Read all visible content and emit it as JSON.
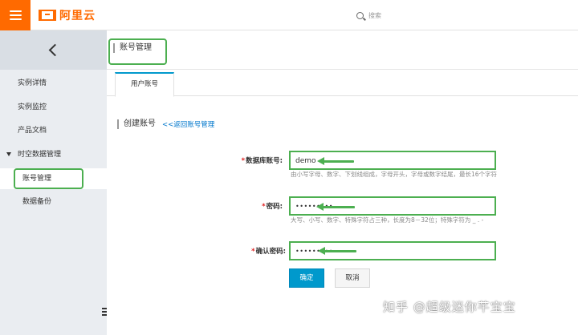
{
  "header": {
    "logo_text": "阿里云",
    "search_placeholder": "搜索"
  },
  "sidebar": {
    "items": [
      {
        "label": "实例详情"
      },
      {
        "label": "实例监控"
      },
      {
        "label": "产品文档"
      }
    ],
    "group": {
      "label": "时空数据管理",
      "expanded": true
    },
    "sub_items": [
      {
        "label": "账号管理",
        "active": true
      },
      {
        "label": "数据备份"
      }
    ]
  },
  "main": {
    "page_title": "账号管理",
    "tabs": [
      {
        "label": "用户账号",
        "active": true
      }
    ],
    "section_title": "创建账号",
    "back_link": "<<返回账号管理",
    "form": {
      "account": {
        "label": "数据库账号:",
        "value": "demo",
        "help": "由小写字母、数字、下划线组成，字母开头，字母或数字结尾，最长16个字符"
      },
      "password": {
        "label": "密码:",
        "value": "•••••••••",
        "help": "大写、小写、数字、特殊字符占三种，长度为8－32位；特殊字符为 _ . -"
      },
      "confirm": {
        "label": "确认密码:",
        "value": "•••••••••"
      },
      "submit_label": "确定",
      "cancel_label": "取消"
    }
  },
  "watermark": "知乎 @超级迷你芊宝宝",
  "colors": {
    "brand": "#ff6a00",
    "primary_button": "#0099cc",
    "annotation_green": "#4caf50",
    "link": "#0077cc",
    "required": "#e02020"
  }
}
